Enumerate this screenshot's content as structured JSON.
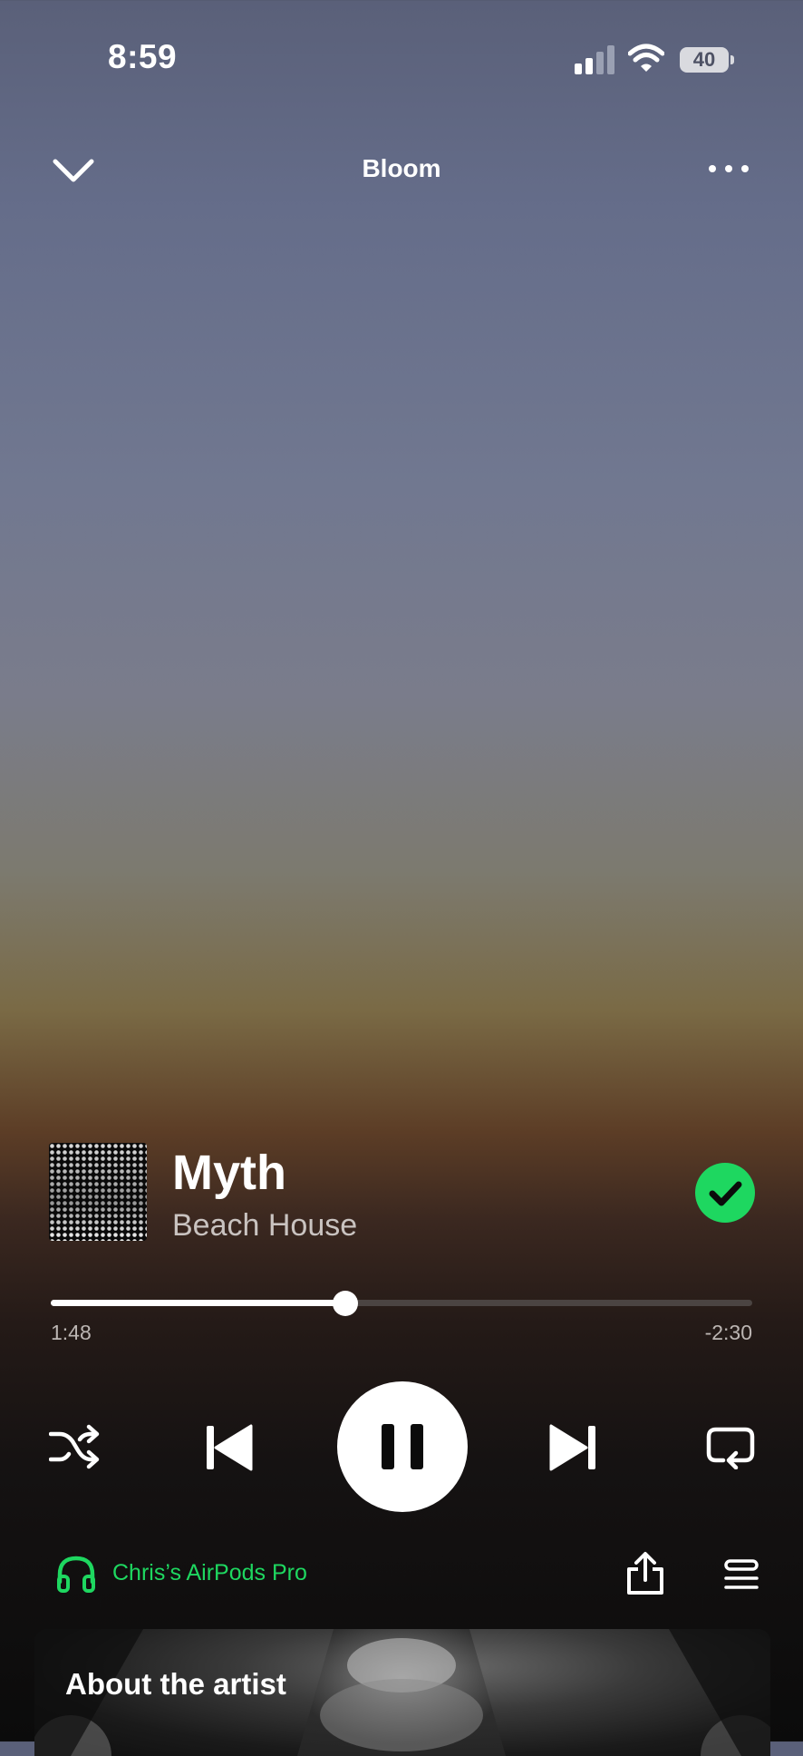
{
  "status_bar": {
    "time": "8:59",
    "battery": "40"
  },
  "header": {
    "title": "Bloom"
  },
  "track": {
    "title": "Myth",
    "artist": "Beach House",
    "liked": true
  },
  "playback": {
    "elapsed": "1:48",
    "remaining": "-2:30",
    "progress": 0.42
  },
  "device": {
    "label": "Chris’s AirPods Pro"
  },
  "about": {
    "title": "About the artist"
  },
  "colors": {
    "accent": "#1ed760",
    "text": "#ffffff",
    "muted": "#bcb6b3"
  },
  "icons": [
    "chevron-down-icon",
    "more-icon",
    "check-icon",
    "shuffle-icon",
    "previous-icon",
    "pause-icon",
    "next-icon",
    "repeat-icon",
    "headphones-icon",
    "share-icon",
    "queue-icon"
  ]
}
